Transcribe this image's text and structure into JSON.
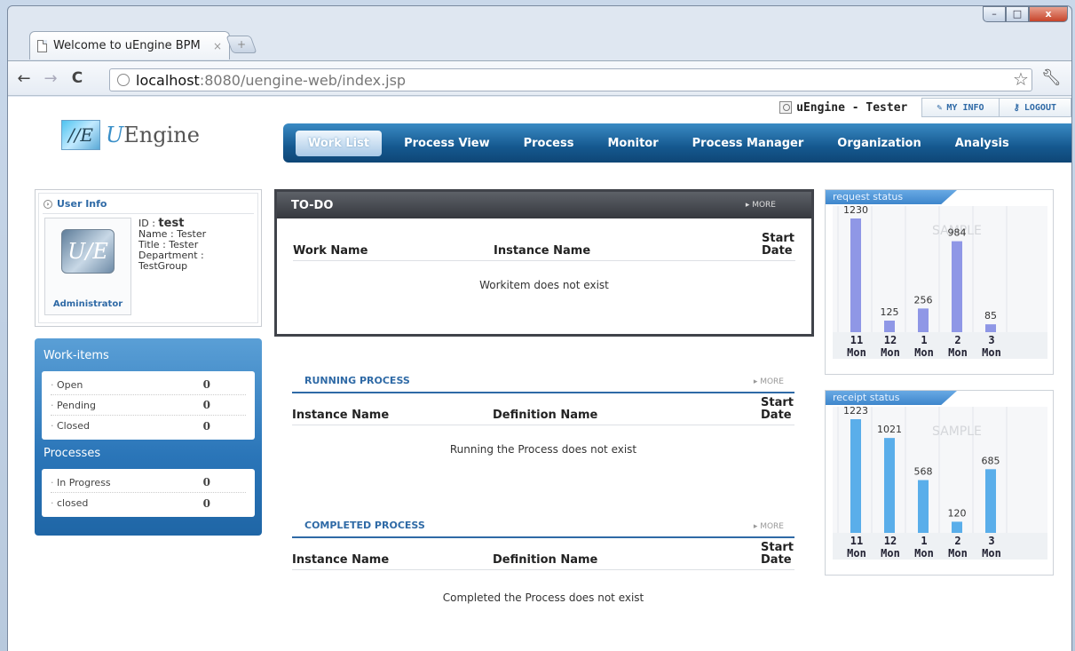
{
  "browser": {
    "tab_title": "Welcome to uEngine BPM",
    "tab_close": "×",
    "newtab": "+",
    "url_host": "localhost",
    "url_rest": ":8080/uengine-web/index.jsp",
    "win_min": "–",
    "win_max": "□",
    "win_close": "x"
  },
  "topbar": {
    "user_label": "uEngine - Tester",
    "my_info": "MY INFO",
    "logout": "LOGOUT",
    "my_info_icon": "pencil-icon",
    "logout_icon": "key-icon"
  },
  "logo": {
    "mark": "//E",
    "prefix": "U",
    "name": "Engine"
  },
  "nav": [
    {
      "label": "Work List"
    },
    {
      "label": "Process View"
    },
    {
      "label": "Process"
    },
    {
      "label": "Monitor"
    },
    {
      "label": "Process Manager"
    },
    {
      "label": "Organization"
    },
    {
      "label": "Analysis"
    }
  ],
  "user_info": {
    "heading": "User Info",
    "avatar_mark": "U/E",
    "role": "Administrator",
    "id_label": "ID : ",
    "id_value": "test",
    "name": "Name : Tester",
    "title": "Title : Tester",
    "department": "Department :",
    "department_value": "TestGroup"
  },
  "workitems": {
    "title": "Work-items",
    "rows": [
      {
        "label": "Open",
        "count": "0"
      },
      {
        "label": "Pending",
        "count": "0"
      },
      {
        "label": "Closed",
        "count": "0"
      }
    ]
  },
  "processes": {
    "title": "Processes",
    "rows": [
      {
        "label": "In Progress",
        "count": "0"
      },
      {
        "label": "closed",
        "count": "0"
      }
    ]
  },
  "todo": {
    "title": "TO-DO",
    "more": "▸ MORE",
    "col1": "Work Name",
    "col2": "Instance Name",
    "col3": "Start Date",
    "empty": "Workitem does not exist"
  },
  "running": {
    "title": "RUNNING PROCESS",
    "more": "▸ MORE",
    "col1": "Instance Name",
    "col2": "Definition Name",
    "col3": "Start Date",
    "empty": "Running the Process does not exist"
  },
  "completed": {
    "title": "COMPLETED PROCESS",
    "more": "▸ MORE",
    "col1": "Instance Name",
    "col2": "Definition Name",
    "col3": "Start Date",
    "empty": "Completed the Process does not exist"
  },
  "chart_data": [
    {
      "type": "bar",
      "title": "request status",
      "watermark": "SAMPLE",
      "categories": [
        "11 Mon",
        "12 Mon",
        "1 Mon",
        "2 Mon",
        "3 Mon"
      ],
      "values": [
        1230,
        125,
        256,
        984,
        85
      ],
      "bar_color": "#8f97e6"
    },
    {
      "type": "bar",
      "title": "receipt status",
      "watermark": "SAMPLE",
      "categories": [
        "11 Mon",
        "12 Mon",
        "1 Mon",
        "2 Mon",
        "3 Mon"
      ],
      "values": [
        1223,
        1021,
        568,
        120,
        685
      ],
      "bar_color": "#5aaeea"
    }
  ]
}
